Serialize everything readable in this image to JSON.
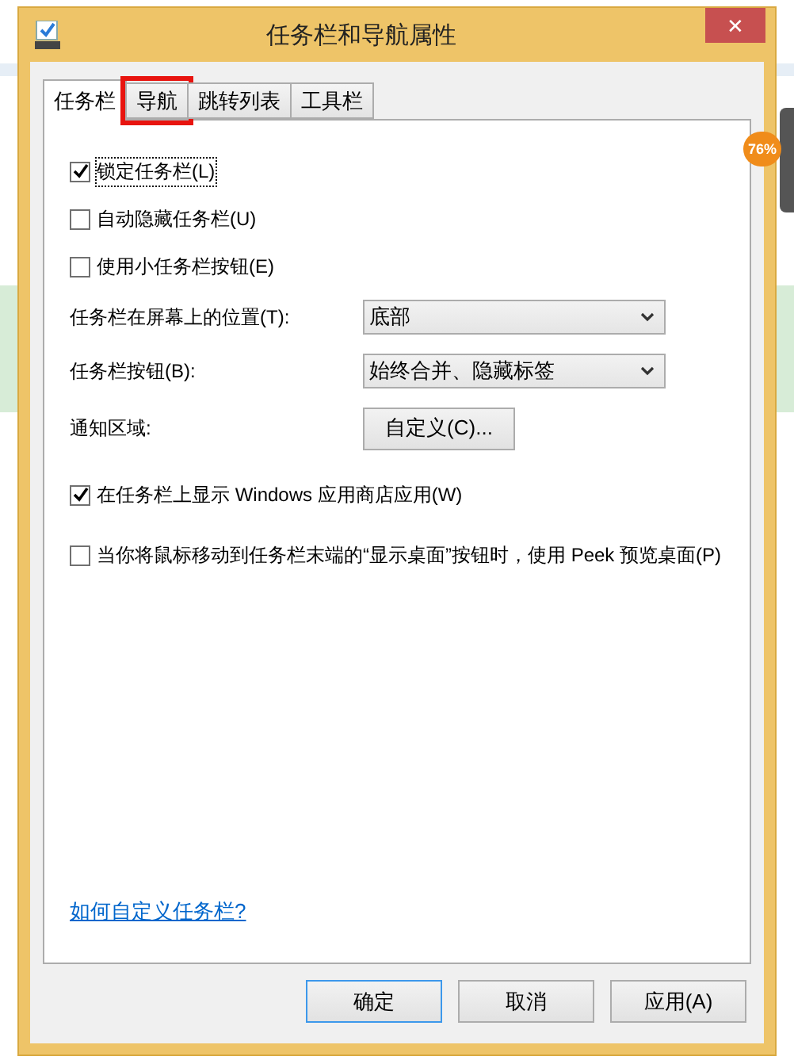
{
  "window": {
    "title": "任务栏和导航属性",
    "close": "✕"
  },
  "tabs": [
    {
      "label": "任务栏",
      "selected": true,
      "highlighted": false
    },
    {
      "label": "导航",
      "selected": false,
      "highlighted": true
    },
    {
      "label": "跳转列表",
      "selected": false,
      "highlighted": false
    },
    {
      "label": "工具栏",
      "selected": false,
      "highlighted": false
    }
  ],
  "options": [
    {
      "kind": "checkbox",
      "label": "锁定任务栏(L)",
      "checked": true,
      "focused": true
    },
    {
      "kind": "checkbox",
      "label": "自动隐藏任务栏(U)",
      "checked": false,
      "focused": false
    },
    {
      "kind": "checkbox",
      "label": "使用小任务栏按钮(E)",
      "checked": false,
      "focused": false
    },
    {
      "kind": "select",
      "label": "任务栏在屏幕上的位置(T):",
      "value": "底部"
    },
    {
      "kind": "select",
      "label": "任务栏按钮(B):",
      "value": "始终合并、隐藏标签"
    },
    {
      "kind": "button",
      "label": "通知区域:",
      "value": "自定义(C)..."
    },
    {
      "kind": "checkbox",
      "label": "在任务栏上显示 Windows 应用商店应用(W)",
      "checked": true,
      "focused": false
    },
    {
      "kind": "checkbox",
      "label": "当你将鼠标移动到任务栏末端的“显示桌面”按钮时，使用 Peek 预览桌面(P)",
      "checked": false,
      "focused": false
    }
  ],
  "help_link": "如何自定义任务栏?",
  "buttons": [
    {
      "label": "确定",
      "default": true
    },
    {
      "label": "取消",
      "default": false
    },
    {
      "label": "应用(A)",
      "default": false
    }
  ],
  "badge": "76%"
}
